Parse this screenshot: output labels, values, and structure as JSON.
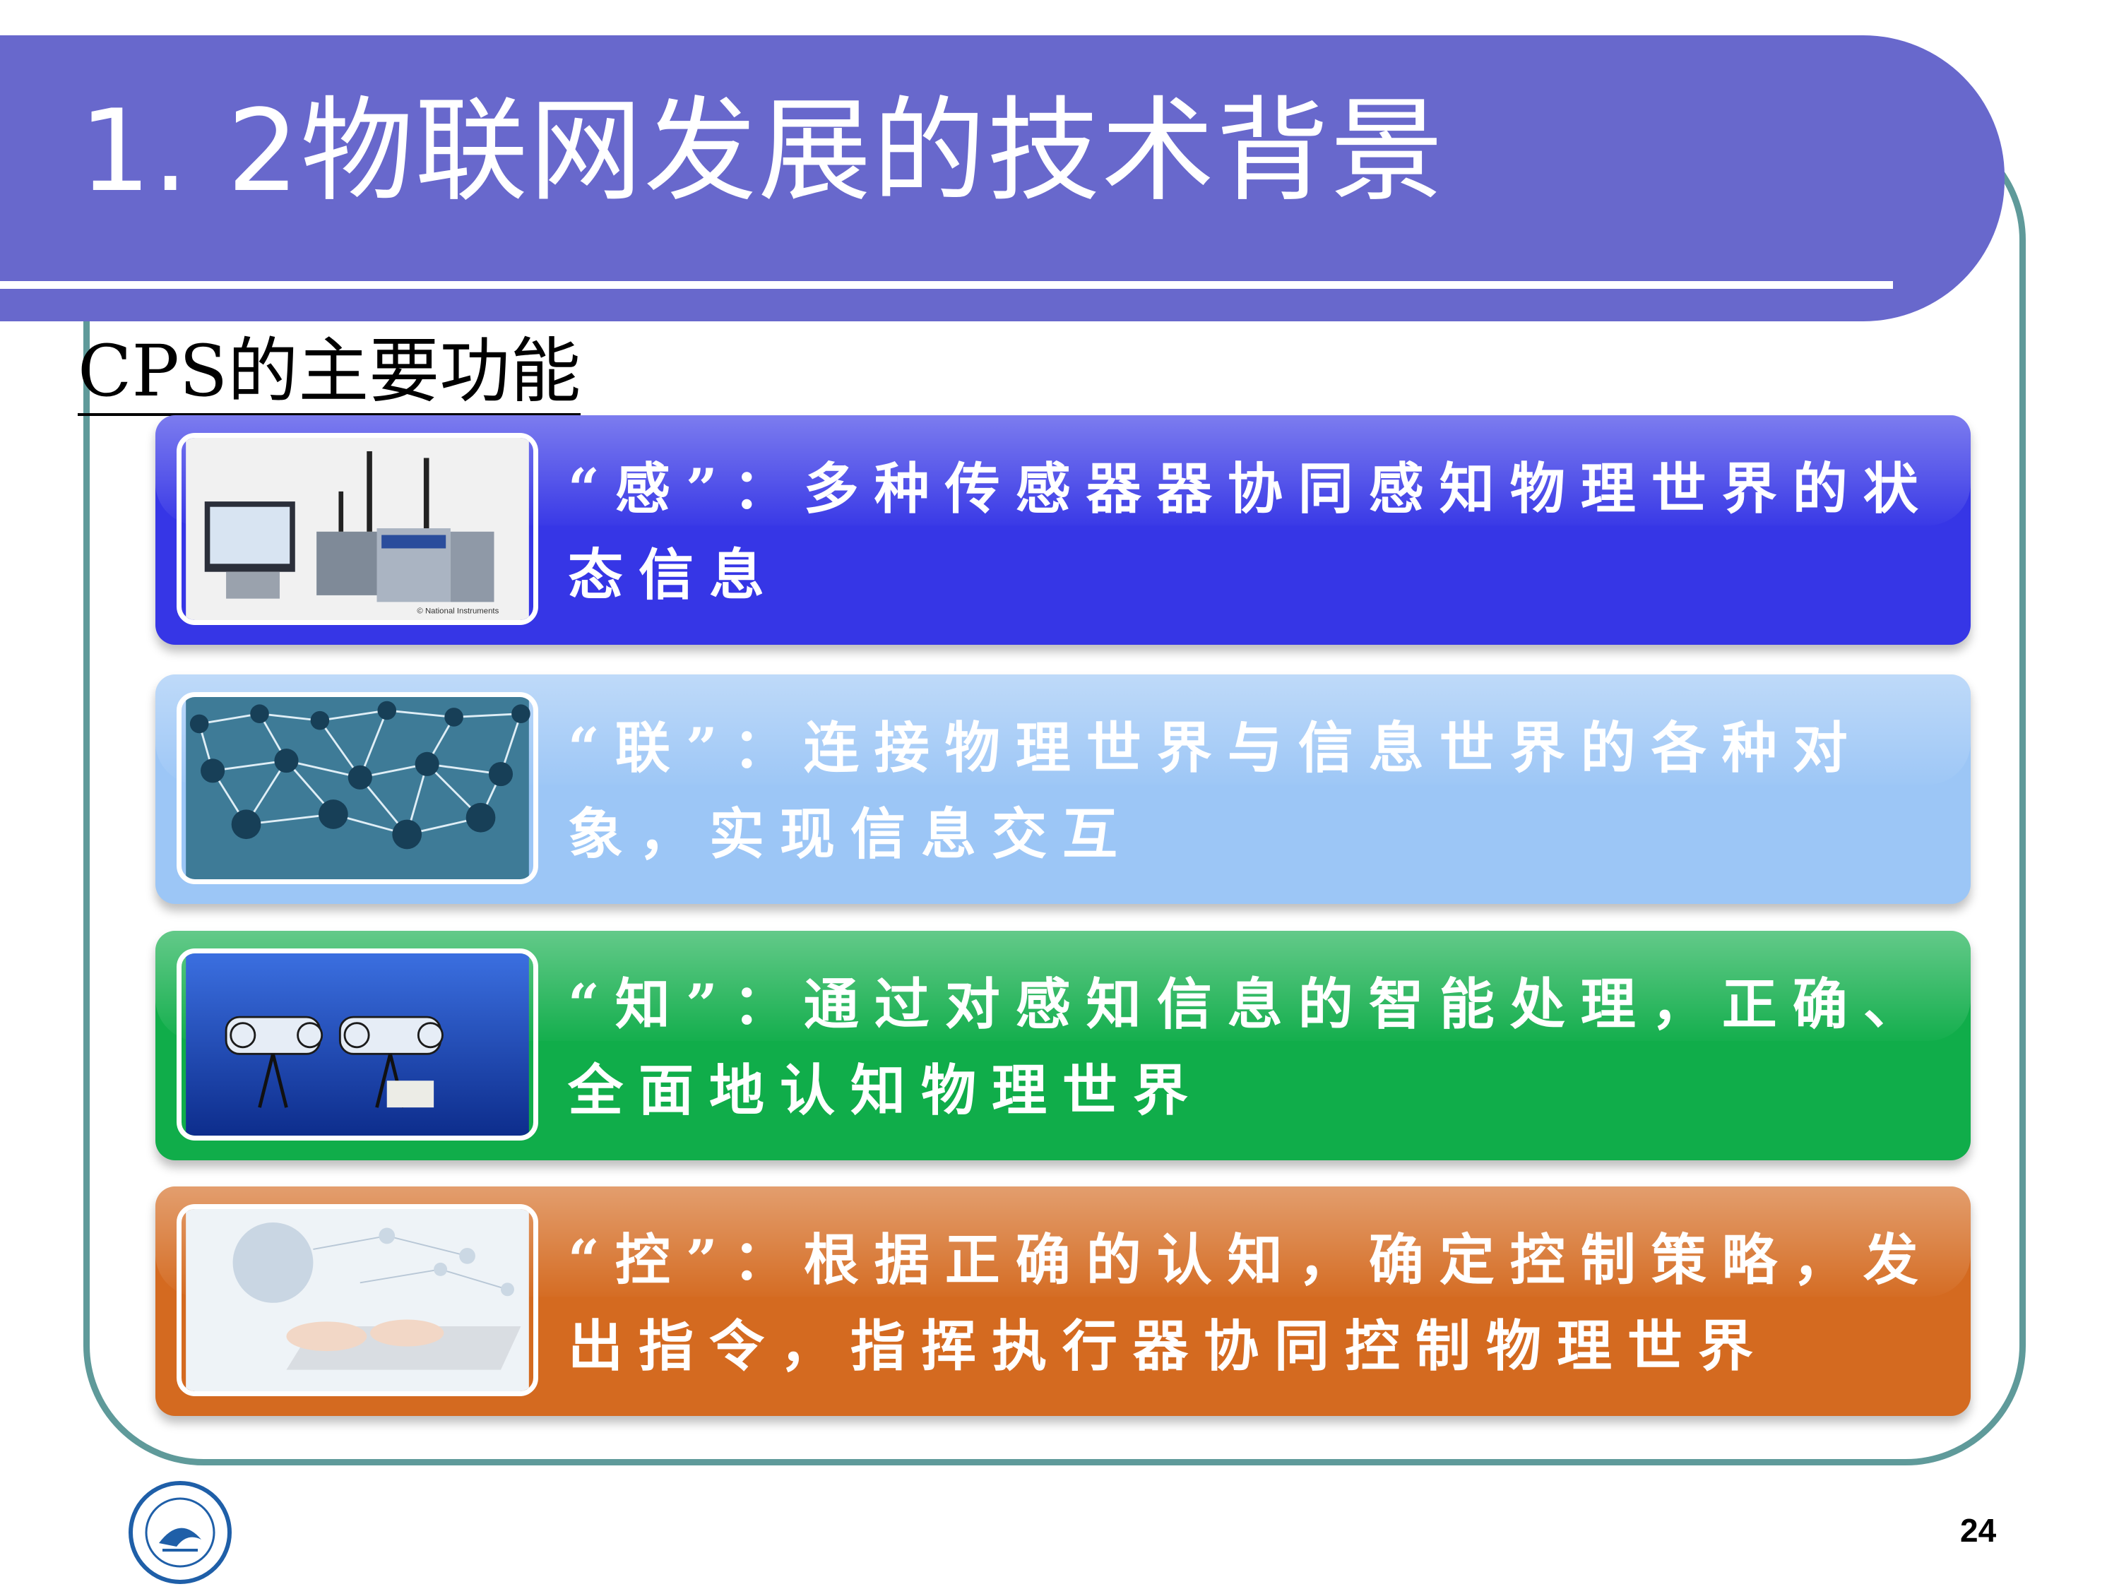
{
  "slide": {
    "title": "1. 2物联网发展的技术背景",
    "subtitle": "CPS的主要功能",
    "page_number": "24"
  },
  "rows": [
    {
      "image": "sensor-devices-image",
      "image_caption": "© National Instruments",
      "text": "“感”：多种传感器器协同感知物理世界的状态信息",
      "color": "#3636e6"
    },
    {
      "image": "network-nodes-image",
      "text": "“联”：连接物理世界与信息世界的各种对象，实现信息交互",
      "color": "#9cc6f6"
    },
    {
      "image": "underwater-robots-image",
      "text": "“知”：通过对感知信息的智能处理，正确、全面地认知物理世界",
      "color": "#10ad4a"
    },
    {
      "image": "laptop-hands-image",
      "text": "“控”：根据正确的认知，确定控制策略，发出指令，指挥执行器协同控制物理世界",
      "color": "#d46a20"
    }
  ],
  "colors": {
    "banner": "#6868cc",
    "frame": "#5f9a9a"
  }
}
